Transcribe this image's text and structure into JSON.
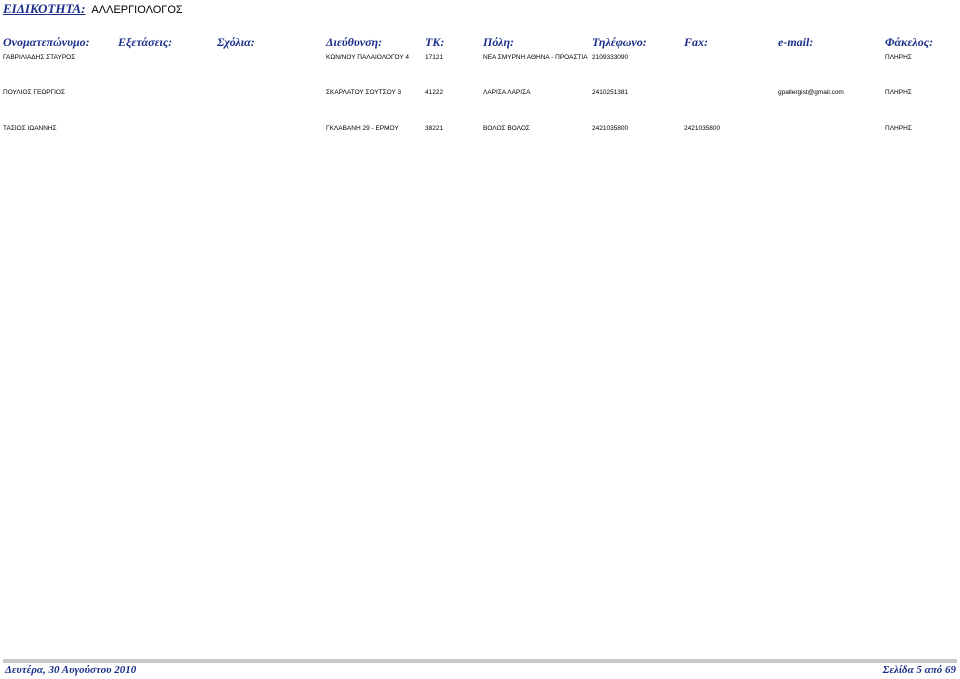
{
  "specialty": {
    "label": "ΕΙΔΙΚΟΤΗΤΑ:",
    "value": "ΑΛΛΕΡΓΙΟΛΟΓΟΣ"
  },
  "columns": {
    "name": "Ονοματεπώνυμο:",
    "exams": "Εξετάσεις:",
    "comments": "Σχόλια:",
    "address": "Διεύθυνση:",
    "zip": "ΤΚ:",
    "city": "Πόλη:",
    "phone": "Τηλέφωνο:",
    "fax": "Fax:",
    "email": "e-mail:",
    "file": "Φάκελος:"
  },
  "rows": [
    {
      "name": "ΓΑΒΡΙΛΙΑΔΗΣ ΣΤΑΥΡΟΣ",
      "address": "ΚΩΝ/ΝΟΥ ΠΑΛΑΙΟΛΟΓΟΥ 4",
      "zip": "17121",
      "city": "ΝΕΑ ΣΜΥΡΝΗ ΑΘΗΝΑ - ΠΡΟΑΣΤΙΑ",
      "phone": "2109333090",
      "fax": "",
      "email": "",
      "file": "ΠΛΗΡΗΣ"
    },
    {
      "name": "ΠΟΥΛΙΟΣ ΓΕΩΡΓΙΟΣ",
      "address": "ΣΚΑΡΛΑΤΟΥ ΣΟΥΤΣΟΥ 3",
      "zip": "41222",
      "city": "ΛΑΡΙΣΑ ΛΑΡΙΣΑ",
      "phone": "2410251381",
      "fax": "",
      "email": "gpallergist@gmail.com",
      "file": "ΠΛΗΡΗΣ"
    },
    {
      "name": "ΤΑΣΙΟΣ ΙΩΑΝΝΗΣ",
      "address": "ΓΚΛΑΒΑΝΗ 29 - ΕΡΜΟΥ",
      "zip": "38221",
      "city": "ΒΟΛΟΣ ΒΟΛΟΣ",
      "phone": "2421035800",
      "fax": "2421035800",
      "email": "",
      "file": "ΠΛΗΡΗΣ"
    }
  ],
  "footer": {
    "date": "Δευτέρα, 30 Αυγούστου 2010",
    "page": "Σελίδα 5 από 69"
  }
}
